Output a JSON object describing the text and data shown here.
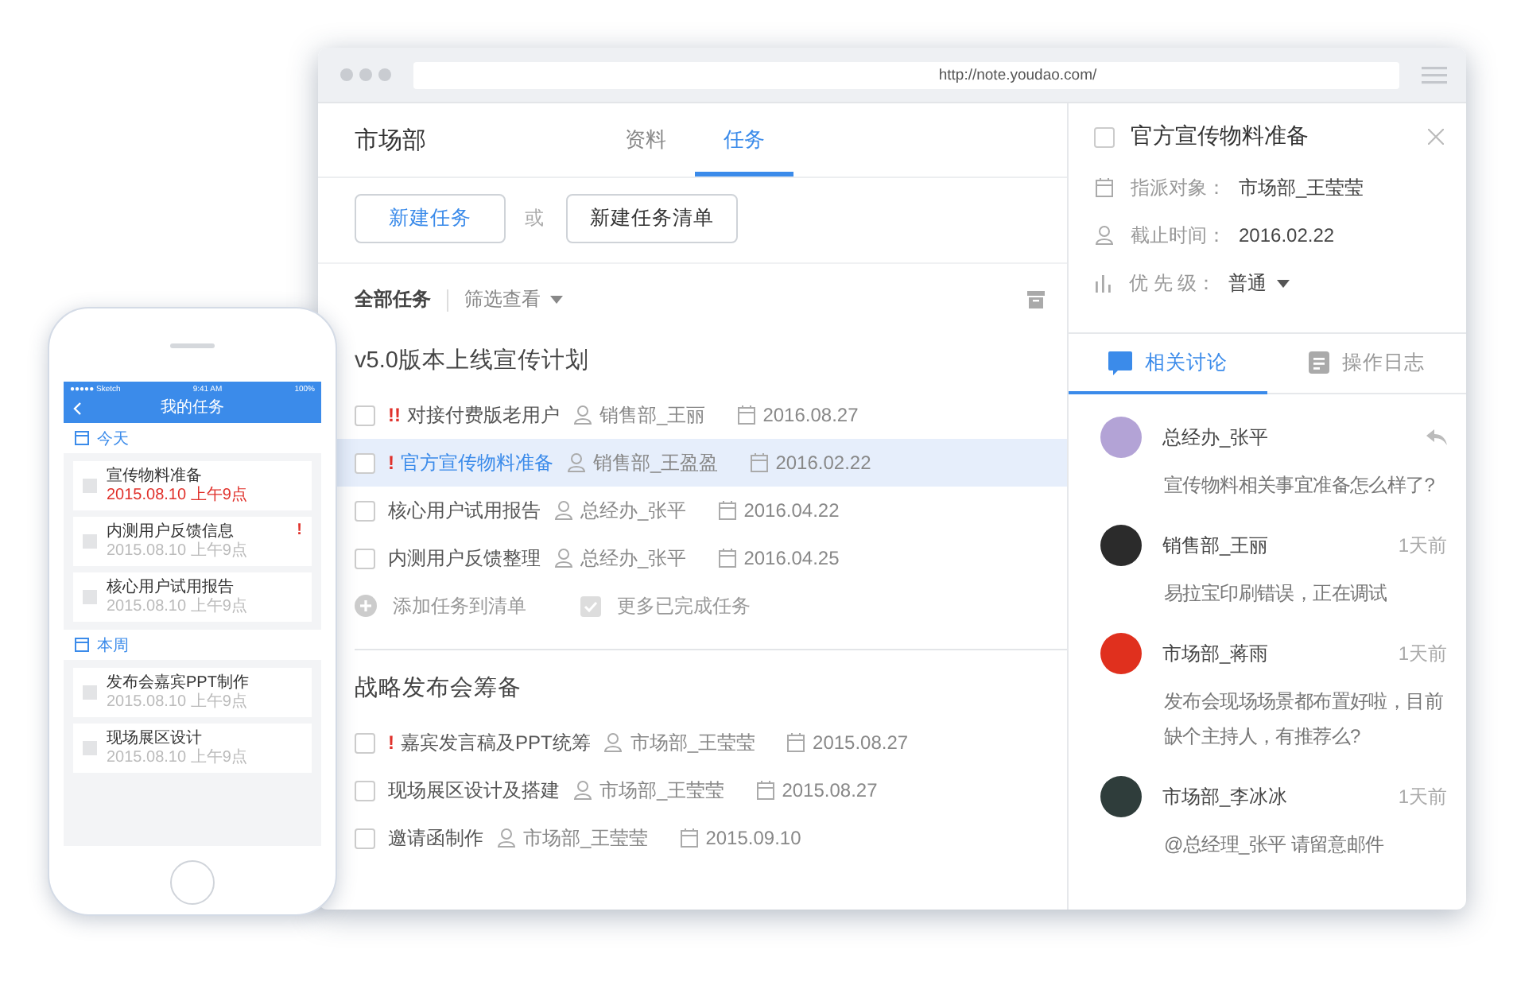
{
  "phone": {
    "status_bar": {
      "carrier": "●●●●● Sketch",
      "time": "9:41 AM",
      "battery": "100%"
    },
    "title": "我的任务",
    "sections": [
      {
        "title": "今天",
        "tasks": [
          {
            "name": "宣传物料准备",
            "time": "2015.08.10 上午9点",
            "overdue": true,
            "checked": false
          },
          {
            "name": "内测用户反馈信息",
            "time": "2015.08.10 上午9点",
            "overdue": false,
            "checked": false,
            "flag": "!"
          },
          {
            "name": "核心用户试用报告",
            "time": "2015.08.10 上午9点",
            "overdue": false,
            "checked": false
          }
        ]
      },
      {
        "title": "本周",
        "tasks": [
          {
            "name": "发布会嘉宾PPT制作",
            "time": "2015.08.10 上午9点",
            "overdue": false,
            "checked": false
          },
          {
            "name": "现场展区设计",
            "time": "2015.08.10 上午9点",
            "overdue": false,
            "checked": false
          }
        ]
      }
    ]
  },
  "browser": {
    "url": "http://note.youdao.com/"
  },
  "tasks_pane": {
    "team": "市场部",
    "tabs": [
      {
        "label": "资料",
        "selected": false
      },
      {
        "label": "任务",
        "selected": true
      }
    ],
    "new_task_button": "新建任务",
    "or_text": "或",
    "new_list_button": "新建任务清单",
    "filter_bar": {
      "all_label": "全部任务",
      "filter_label": "筛选查看"
    },
    "lists": [
      {
        "title": "v5.0版本上线宣传计划",
        "tasks": [
          {
            "flag": "!!",
            "title": "对接付费版老用户",
            "assignee": "销售部_王丽",
            "due": "2016.08.27",
            "selected": false,
            "checked": false
          },
          {
            "flag": "!",
            "title": "官方宣传物料准备",
            "assignee": "销售部_王盈盈",
            "due": "2016.02.22",
            "selected": true,
            "checked": false
          },
          {
            "title": "核心用户试用报告",
            "assignee": "总经办_张平",
            "due": "2016.04.22",
            "selected": false,
            "checked": false
          },
          {
            "title": "内测用户反馈整理",
            "assignee": "总经办_张平",
            "due": "2016.04.25",
            "selected": false,
            "checked": false
          }
        ],
        "add_label": "添加任务到清单",
        "more_label": "更多已完成任务"
      },
      {
        "title": "战略发布会筹备",
        "tasks": [
          {
            "flag": "!",
            "title": "嘉宾发言稿及PPT统筹",
            "assignee": "市场部_王莹莹",
            "due": "2015.08.27",
            "selected": false,
            "checked": false
          },
          {
            "title": "现场展区设计及搭建",
            "assignee": "市场部_王莹莹",
            "due": "2015.08.27",
            "selected": false,
            "checked": false
          },
          {
            "title": "邀请函制作",
            "assignee": "市场部_王莹莹",
            "due": "2015.09.10",
            "selected": false,
            "checked": false
          }
        ]
      }
    ]
  },
  "detail_pane": {
    "checked": false,
    "title": "官方宣传物料准备",
    "fields": [
      {
        "kind": "calendar",
        "label": "指派对象：",
        "value": "市场部_王莹莹",
        "dropdown": false
      },
      {
        "kind": "person",
        "label": "截止时间：",
        "value": "2016.02.22",
        "dropdown": false
      },
      {
        "kind": "bars",
        "label": "优 先 级：",
        "value": "普通",
        "dropdown": true
      }
    ],
    "tabs": [
      {
        "kind": "chat",
        "label": "相关讨论",
        "selected": true
      },
      {
        "kind": "doc",
        "label": "操作日志",
        "selected": false
      }
    ],
    "comments": [
      {
        "author": "总经办_张平",
        "reply": true,
        "color": "#b3a3d6",
        "text": "宣传物料相关事宜准备怎么样了?"
      },
      {
        "author": "销售部_王丽",
        "time": "1天前",
        "reply": false,
        "color": "#2b2b2b",
        "text": "易拉宝印刷错误，正在调试"
      },
      {
        "author": "市场部_蒋雨",
        "time": "1天前",
        "reply": false,
        "color": "#e0301e",
        "text": "发布会现场场景都布置好啦，目前缺个主持人，有推荐么?"
      },
      {
        "author": "市场部_李冰冰",
        "time": "1天前",
        "reply": false,
        "color": "#2f3d3b",
        "text": "@总经理_张平  请留意邮件"
      }
    ]
  }
}
